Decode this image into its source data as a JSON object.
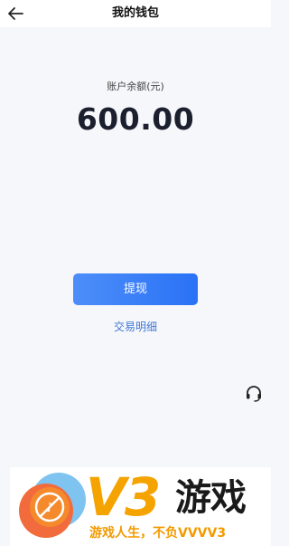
{
  "header": {
    "title": "我的钱包",
    "back_icon": "arrow-left-icon"
  },
  "wallet": {
    "balance_label": "账户余额(元)",
    "balance_value": "600.00",
    "withdraw_label": "提现",
    "details_label": "交易明细"
  },
  "service": {
    "icon": "headset-icon"
  },
  "watermark": {
    "brand": "V3",
    "title": "游戏",
    "slogan": "游戏人生，不负VVVV3"
  },
  "colors": {
    "accent": "#2a72f6",
    "link": "#3f78d6",
    "background": "#f6f7fa",
    "watermark_orange": "#f5a300"
  }
}
